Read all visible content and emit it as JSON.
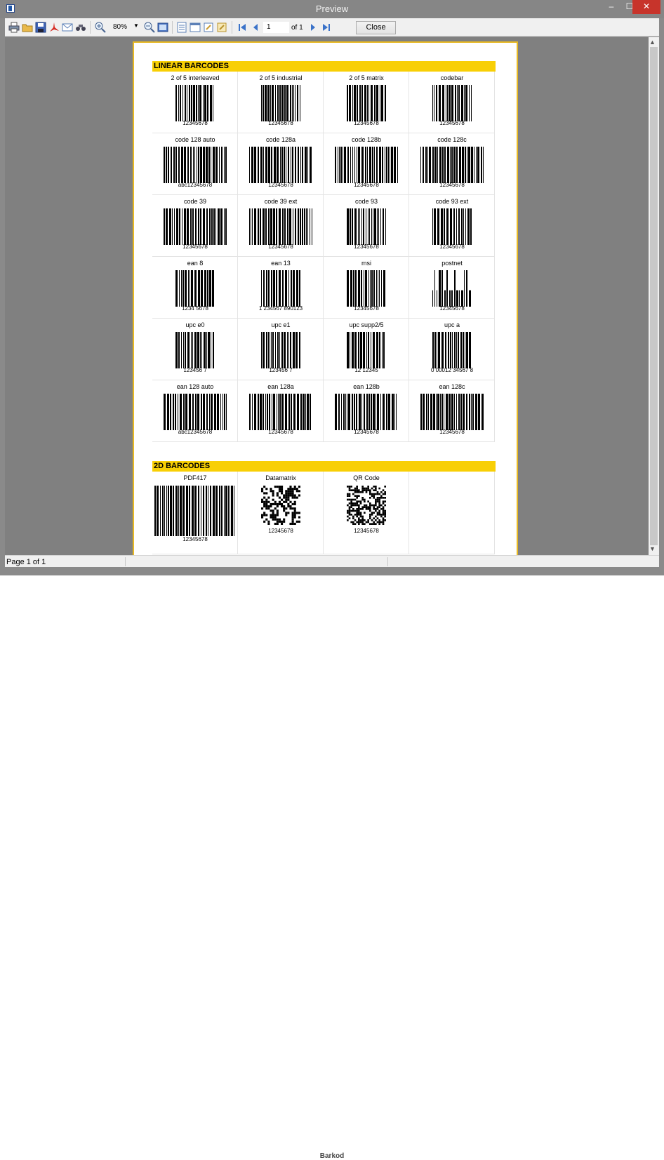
{
  "window": {
    "title": "Preview",
    "minimize": "–",
    "maximize": "☐",
    "close": "✕"
  },
  "toolbar": {
    "icons": [
      "print-icon",
      "open-icon",
      "save-icon",
      "pdf-icon",
      "email-icon",
      "find-icon",
      "zoom-in-icon",
      "zoom-out-icon",
      "fit-page-icon",
      "page-setup-icon",
      "single-page-icon",
      "edit-icon",
      "watermark-icon",
      "first-page-icon",
      "prev-page-icon",
      "next-page-icon",
      "last-page-icon"
    ],
    "zoom": "80%",
    "page_value": "1",
    "page_of": "of 1",
    "close_label": "Close"
  },
  "status": {
    "page_text": "Page 1 of 1"
  },
  "caption": "Barkod",
  "report": {
    "linear_title": "LINEAR BARCODES",
    "linear": [
      {
        "label": "2 of 5 interleaved",
        "code": "12345678"
      },
      {
        "label": "2 of 5 industrial",
        "code": "12345678"
      },
      {
        "label": "2 of 5 matrix",
        "code": "12345678"
      },
      {
        "label": "codebar",
        "code": "12345678"
      },
      {
        "label": "code 128 auto",
        "code": "abc12345678"
      },
      {
        "label": "code 128a",
        "code": "12345678"
      },
      {
        "label": "code 128b",
        "code": "12345678"
      },
      {
        "label": "code 128c",
        "code": "12345678"
      },
      {
        "label": "code 39",
        "code": "12345678"
      },
      {
        "label": "code 39 ext",
        "code": "12345678"
      },
      {
        "label": "code 93",
        "code": "12345678"
      },
      {
        "label": "code 93 ext",
        "code": "12345678"
      },
      {
        "label": "ean 8",
        "code": "1234 5678"
      },
      {
        "label": "ean 13",
        "code": "1 234567 890123"
      },
      {
        "label": "msi",
        "code": "12345678"
      },
      {
        "label": "postnet",
        "code": "12345678"
      },
      {
        "label": "upc e0",
        "code": "123456 7"
      },
      {
        "label": "upc e1",
        "code": "123456 7"
      },
      {
        "label": "upc supp2/5",
        "code": "12       12345"
      },
      {
        "label": "upc a",
        "code": "0 00012 34567 8"
      },
      {
        "label": "ean 128 auto",
        "code": "abc12345678"
      },
      {
        "label": "ean 128a",
        "code": "12345678"
      },
      {
        "label": "ean 128b",
        "code": "12345678"
      },
      {
        "label": "ean 128c",
        "code": "12345678"
      }
    ],
    "twod_title": "2D BARCODES",
    "twod": [
      {
        "label": "PDF417",
        "code": "12345678"
      },
      {
        "label": "Datamatrix",
        "code": "12345678"
      },
      {
        "label": "QR Code",
        "code": "12345678"
      }
    ]
  }
}
